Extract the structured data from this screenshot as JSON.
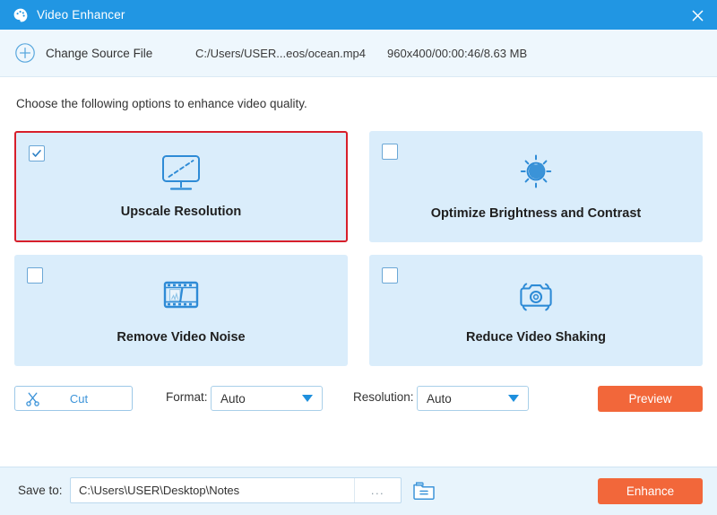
{
  "window": {
    "title": "Video Enhancer",
    "logo_icon": "palette-icon",
    "close_icon": "close-icon",
    "titlebar_color": "#2196e3"
  },
  "source_bar": {
    "add_icon": "plus-circle-icon",
    "change_source_label": "Change Source File",
    "file_path": "C:/Users/USER...eos/ocean.mp4",
    "file_meta": "960x400/00:00:46/8.63 MB"
  },
  "instruction": "Choose the following options to enhance video quality.",
  "options": [
    {
      "label": "Upscale Resolution",
      "icon": "monitor-upscale-icon",
      "checked": true,
      "selected": true
    },
    {
      "label": "Optimize Brightness and Contrast",
      "icon": "sun-brightness-icon",
      "checked": false,
      "selected": false
    },
    {
      "label": "Remove Video Noise",
      "icon": "film-strip-icon",
      "checked": false,
      "selected": false
    },
    {
      "label": "Reduce Video Shaking",
      "icon": "camera-shake-icon",
      "checked": false,
      "selected": false
    }
  ],
  "controls": {
    "cut_label": "Cut",
    "cut_icon": "scissors-icon",
    "format_label": "Format:",
    "format_value": "Auto",
    "resolution_label": "Resolution:",
    "resolution_value": "Auto",
    "preview_label": "Preview",
    "dropdown_icon": "chevron-down-icon"
  },
  "bottom": {
    "save_to_label": "Save to:",
    "save_path": "C:\\Users\\USER\\Desktop\\Notes",
    "browse_label": "...",
    "folder_icon": "folder-icon",
    "enhance_label": "Enhance"
  },
  "colors": {
    "accent_blue": "#2196e3",
    "action_orange": "#f2673a",
    "card_blue": "#daedfb",
    "selection_red": "#d71f2b"
  }
}
